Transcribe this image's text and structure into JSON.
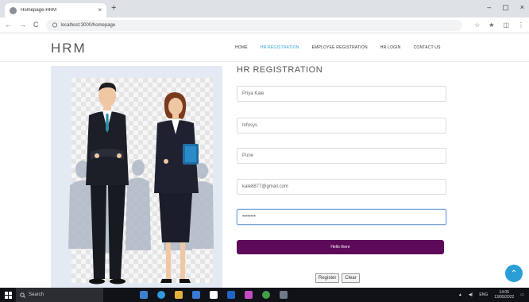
{
  "browser": {
    "tab_title": "Homepage-HRM",
    "tab_close": "×",
    "new_tab": "+",
    "window_controls": [
      "–",
      "▢",
      "×"
    ],
    "nav_icons": [
      "back-icon",
      "forward-icon",
      "reload-icon"
    ],
    "nav_glyphs": [
      "←",
      "→",
      "C"
    ],
    "url": "localhost:3000/homepage",
    "toolbar_icons": [
      "bookmark-icon",
      "star-icon",
      "extension-icon",
      "menu-icon"
    ],
    "toolbar_glyphs": [
      "☆",
      "★",
      "◫",
      "⋮"
    ]
  },
  "header": {
    "logo": "HRM",
    "nav": [
      {
        "label": "HOME",
        "active": false
      },
      {
        "label": "HR REGISTRATION",
        "active": true
      },
      {
        "label": "EMPLOYEE REGISTRATION",
        "active": false
      },
      {
        "label": "HR LOGIN",
        "active": false
      },
      {
        "label": "CONTACT US",
        "active": false
      }
    ]
  },
  "form": {
    "title": "HR REGISTRATION",
    "fields": [
      {
        "name": "full-name-field",
        "value": "Priya Kale"
      },
      {
        "name": "company-field",
        "value": "Infosys"
      },
      {
        "name": "city-field",
        "value": "Pune"
      },
      {
        "name": "email-field",
        "value": "kale8877@gmail.com"
      },
      {
        "name": "password-field",
        "value": "••••••••"
      }
    ],
    "submit_label": "Hello there",
    "register_label": "Register",
    "clear_label": "Clear"
  },
  "fab_icon": "chevron-up-icon",
  "fab_glyph": "⌃",
  "taskbar": {
    "search_placeholder": "Search",
    "clock_time": "14:05",
    "clock_date": "13/05/2022",
    "lang": "ENG"
  },
  "colors": {
    "accent": "#2a9fd6",
    "submit": "#5d0a5a",
    "taskbar": "#101217"
  }
}
